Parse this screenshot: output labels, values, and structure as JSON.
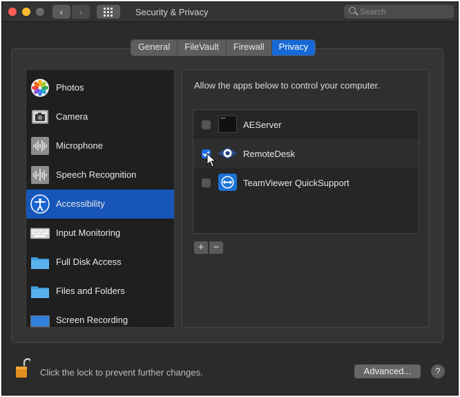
{
  "window": {
    "title": "Security & Privacy",
    "search_placeholder": "Search"
  },
  "tabs": [
    {
      "label": "General",
      "active": false
    },
    {
      "label": "FileVault",
      "active": false
    },
    {
      "label": "Firewall",
      "active": false
    },
    {
      "label": "Privacy",
      "active": true
    }
  ],
  "sidebar": {
    "items": [
      {
        "label": "Photos",
        "icon": "photos-icon",
        "selected": false
      },
      {
        "label": "Camera",
        "icon": "camera-icon",
        "selected": false
      },
      {
        "label": "Microphone",
        "icon": "microphone-icon",
        "selected": false
      },
      {
        "label": "Speech Recognition",
        "icon": "speech-recognition-icon",
        "selected": false
      },
      {
        "label": "Accessibility",
        "icon": "accessibility-icon",
        "selected": true
      },
      {
        "label": "Input Monitoring",
        "icon": "keyboard-icon",
        "selected": false
      },
      {
        "label": "Full Disk Access",
        "icon": "folder-icon",
        "selected": false
      },
      {
        "label": "Files and Folders",
        "icon": "folder-icon",
        "selected": false
      },
      {
        "label": "Screen Recording",
        "icon": "screen-recording-icon",
        "selected": false
      }
    ]
  },
  "main": {
    "description": "Allow the apps below to control your computer.",
    "apps": [
      {
        "name": "AEServer",
        "checked": false,
        "icon": "terminal-icon"
      },
      {
        "name": "RemoteDesk",
        "checked": true,
        "icon": "remotedesk-icon"
      },
      {
        "name": "TeamViewer QuickSupport",
        "checked": false,
        "icon": "teamviewer-icon"
      }
    ],
    "add_label": "+",
    "remove_label": "−"
  },
  "footer": {
    "lock_text": "Click the lock to prevent further changes.",
    "advanced_label": "Advanced...",
    "help_label": "?"
  },
  "colors": {
    "accent": "#1669d6",
    "sidebar_selected": "#1756b8",
    "window_bg": "#2b2b2b"
  }
}
